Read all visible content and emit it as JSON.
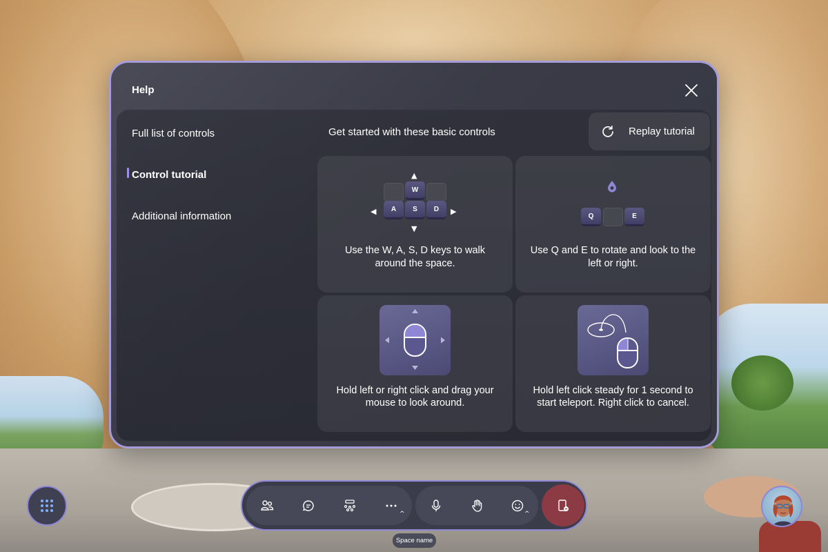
{
  "dialog": {
    "title": "Help",
    "close_icon": "close-icon"
  },
  "nav": {
    "items": [
      {
        "label": "Full list of controls",
        "active": false
      },
      {
        "label": "Control tutorial",
        "active": true
      },
      {
        "label": "Additional information",
        "active": false
      }
    ]
  },
  "main": {
    "heading": "Get started with these basic controls",
    "replay_label": "Replay tutorial",
    "replay_icon": "refresh-icon",
    "cards": [
      {
        "icon": "wasd-keys",
        "keys": [
          "W",
          "A",
          "S",
          "D"
        ],
        "caption_line1": "Use the W, A, S, D keys to walk",
        "caption_line2": "around the space."
      },
      {
        "icon": "qe-keys",
        "keys": [
          "Q",
          "E"
        ],
        "caption_line1": "Use Q and E to rotate and look to the",
        "caption_line2": "left or right."
      },
      {
        "icon": "mouse-drag-icon",
        "caption_line1": "Hold left or right click and drag your",
        "caption_line2": "mouse to look around."
      },
      {
        "icon": "mouse-teleport-icon",
        "caption_line1": "Hold left click steady for 1 second to",
        "caption_line2": "start teleport. Right click to cancel."
      }
    ]
  },
  "toolbar": {
    "buttons": [
      {
        "icon": "people-icon"
      },
      {
        "icon": "chat-icon"
      },
      {
        "icon": "spaces-icon"
      },
      {
        "icon": "more-icon"
      },
      {
        "icon": "microphone-icon"
      },
      {
        "icon": "raise-hand-icon"
      },
      {
        "icon": "emoji-icon"
      },
      {
        "icon": "leave-icon"
      }
    ],
    "space_name": "Space name"
  },
  "colors": {
    "accent": "#9d8ff0",
    "leave": "#8c3b44",
    "dialog_bg": "#3a3b46"
  }
}
